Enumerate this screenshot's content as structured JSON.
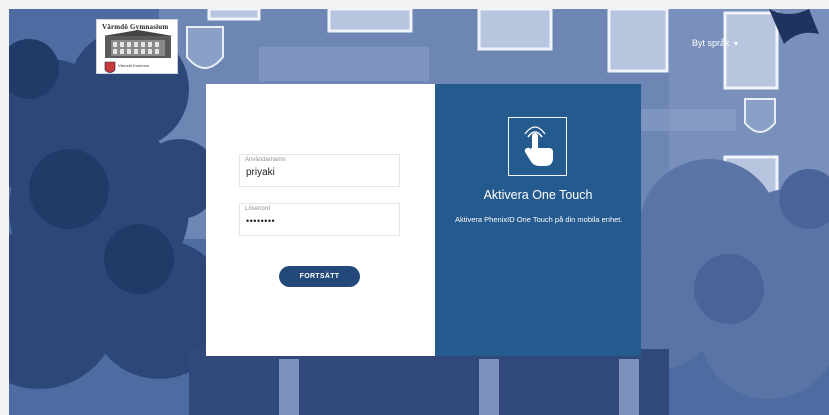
{
  "logo": {
    "title": "Värmdö Gymnasium",
    "subtitle": "Värmdö Kommun"
  },
  "header": {
    "language_label": "Byt språk"
  },
  "login": {
    "username": {
      "label": "Användarnamn",
      "value": "priyaki"
    },
    "password": {
      "label": "Lösenord",
      "value": "••••••••"
    },
    "submit_label": "FORTSÄTT"
  },
  "one_touch": {
    "title": "Aktivera One Touch",
    "description": "Aktivera PhenixID One Touch på din mobila enhet."
  },
  "colors": {
    "accent": "#245a8e",
    "button": "#23497a",
    "background_tint": "#3f5d92"
  },
  "icons": {
    "language": "chevron-down-icon",
    "one_touch": "touch-hand-icon"
  }
}
